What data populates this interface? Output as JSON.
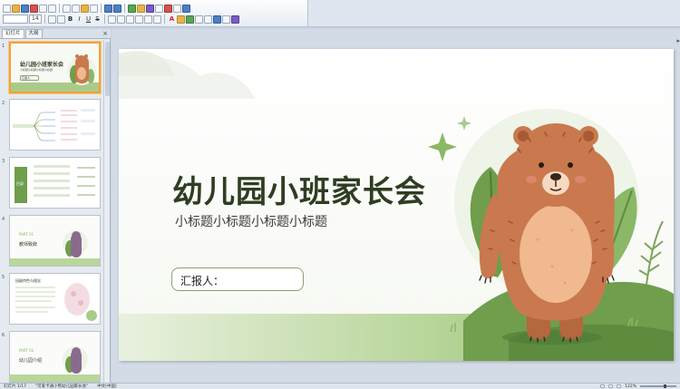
{
  "toolbar": {
    "font_size": "14",
    "bold_label": "B",
    "italic_label": "I",
    "underline_label": "U",
    "strike_label": "S",
    "font_color_label": "A"
  },
  "left_pane": {
    "tabs": [
      {
        "label": "幻灯片",
        "active": true
      },
      {
        "label": "大纲",
        "active": false
      }
    ],
    "close_label": "×",
    "thumbnails": [
      {
        "number": "1",
        "title": "幼儿园小班家长会",
        "subtitle": "小标题小标题小标题小标题",
        "reporter": "汇报人："
      },
      {
        "number": "2"
      },
      {
        "number": "3",
        "tag": "目录"
      },
      {
        "number": "4",
        "part": "PART 01",
        "heading": "教师致辞"
      },
      {
        "number": "5",
        "heading": "班级特色与理念"
      },
      {
        "number": "6",
        "part": "PART 02",
        "heading": "幼儿园介绍"
      }
    ]
  },
  "slide": {
    "title": "幼儿园小班家长会",
    "subtitle": "小标题小标题小标题小标题",
    "reporter_label": "汇报人："
  },
  "statusbar": {
    "slide_info": "幻灯片 1/17",
    "theme": "\"可爱卡通小熊幼儿园家长会\"",
    "language": "中文(中国)",
    "zoom": "122%"
  },
  "colors": {
    "title": "#2f3d22",
    "leaf_dark": "#5e8c3f",
    "leaf_light": "#a9cb8a",
    "bear_fur": "#c9794d",
    "bear_belly": "#f1b98f",
    "selection": "#f0a23a"
  }
}
